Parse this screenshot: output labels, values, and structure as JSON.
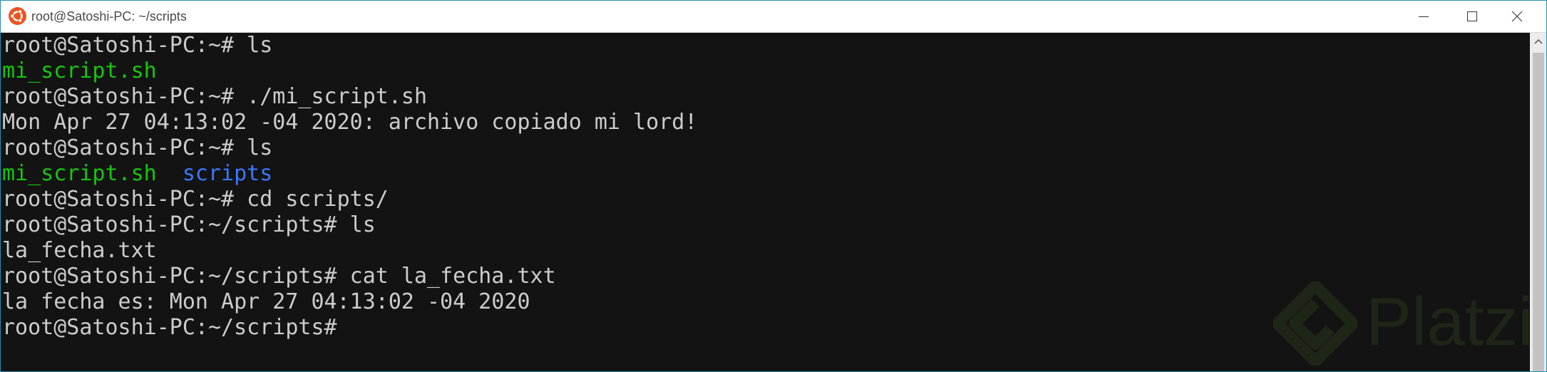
{
  "window": {
    "title": "root@Satoshi-PC: ~/scripts",
    "app_icon": "ubuntu-icon"
  },
  "controls": {
    "minimize_icon": "minimize-icon",
    "maximize_icon": "maximize-icon",
    "close_icon": "close-icon"
  },
  "colors": {
    "background": "#131313",
    "text": "#cccccc",
    "executable": "#16c60c",
    "directory": "#3b78ff",
    "titlebar": "#ffffff",
    "border": "#2b8bb8"
  },
  "terminal": {
    "lines": [
      [
        {
          "text": "root@Satoshi-PC:~# ls",
          "style": "normal"
        }
      ],
      [
        {
          "text": "mi_script.sh",
          "style": "exec"
        }
      ],
      [
        {
          "text": "root@Satoshi-PC:~# ./mi_script.sh",
          "style": "normal"
        }
      ],
      [
        {
          "text": "Mon Apr 27 04:13:02 -04 2020: archivo copiado mi lord!",
          "style": "normal"
        }
      ],
      [
        {
          "text": "root@Satoshi-PC:~# ls",
          "style": "normal"
        }
      ],
      [
        {
          "text": "mi_script.sh",
          "style": "exec"
        },
        {
          "text": "  ",
          "style": "normal"
        },
        {
          "text": "scripts",
          "style": "dir"
        }
      ],
      [
        {
          "text": "root@Satoshi-PC:~# cd scripts/",
          "style": "normal"
        }
      ],
      [
        {
          "text": "root@Satoshi-PC:~/scripts# ls",
          "style": "normal"
        }
      ],
      [
        {
          "text": "la_fecha.txt",
          "style": "normal"
        }
      ],
      [
        {
          "text": "root@Satoshi-PC:~/scripts# cat la_fecha.txt",
          "style": "normal"
        }
      ],
      [
        {
          "text": "la fecha es: Mon Apr 27 04:13:02 -04 2020",
          "style": "normal"
        }
      ],
      [
        {
          "text": "root@Satoshi-PC:~/scripts#",
          "style": "normal"
        }
      ]
    ]
  },
  "watermark": {
    "text": "Platzi",
    "icon": "platzi-logo-icon"
  }
}
